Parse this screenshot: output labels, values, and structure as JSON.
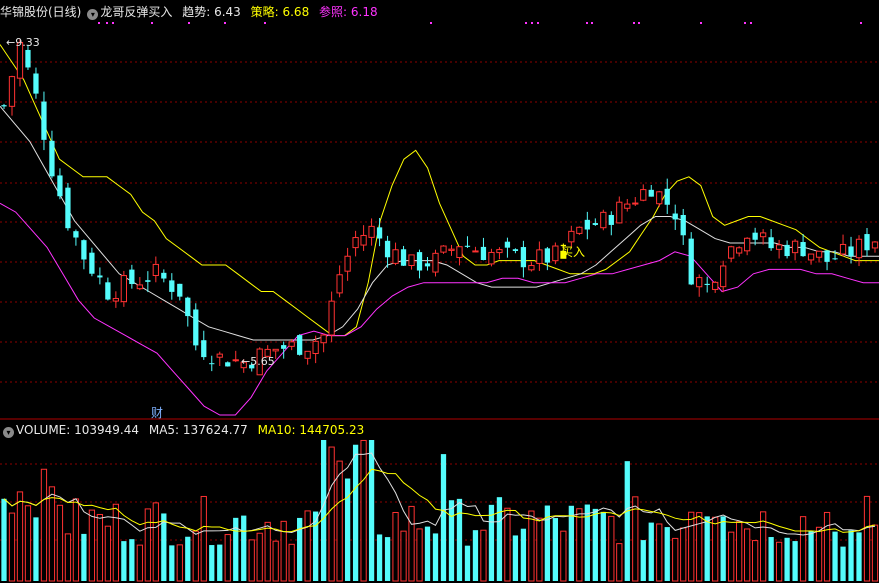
{
  "header": {
    "stock_name": "华锦股份(日线)",
    "indicator_name": "龙哥反弹买入",
    "trend_label": "趋势: ",
    "trend_value": "6.43",
    "strategy_label": "策略: ",
    "strategy_value": "6.68",
    "reference_label": "参照: ",
    "reference_value": "6.18"
  },
  "volume_header": {
    "volume_label": "VOLUME: ",
    "volume_value": "103949.44",
    "ma5_label": "MA5: ",
    "ma5_value": "137624.77",
    "ma10_label": "MA10: ",
    "ma10_value": "144705.23"
  },
  "annotations": {
    "high": "9.33",
    "low": "5.65",
    "buy": "买入",
    "finance": "财"
  },
  "colors": {
    "up": "#ff3232",
    "down": "#54fcfc",
    "trend": "#ffff00",
    "strategy": "#e0e0e0",
    "reference": "#ff33ff",
    "buy_bar": "#ffff00",
    "grid": "#8b0000"
  },
  "chart_data": [
    {
      "type": "candlestick",
      "series": [
        {
          "name": "趋势",
          "values": [
            9.3,
            9.1,
            8.9,
            8.6,
            8.3,
            8.0,
            7.9,
            7.8,
            7.8,
            7.8,
            7.7,
            7.6,
            7.4,
            7.3,
            7.1,
            7.0,
            6.9,
            6.8,
            6.8,
            6.8,
            6.7,
            6.6,
            6.5,
            6.5,
            6.4,
            6.3,
            6.2,
            6.1,
            6.0,
            6.0,
            6.1,
            6.6,
            7.3,
            7.7,
            8.0,
            8.1,
            7.9,
            7.5,
            7.2,
            6.9,
            6.8,
            6.8,
            6.85,
            6.85,
            6.85,
            6.85,
            6.8,
            6.75,
            6.7,
            6.7,
            6.7,
            6.75,
            6.85,
            6.95,
            7.15,
            7.35,
            7.6,
            7.75,
            7.8,
            7.7,
            7.35,
            7.25,
            7.3,
            7.35,
            7.35,
            7.3,
            7.25,
            7.2,
            7.1,
            7.0,
            6.95,
            6.9,
            6.85,
            6.85,
            6.85
          ]
        },
        {
          "name": "策略",
          "values": [
            8.6,
            8.4,
            8.2,
            7.9,
            7.6,
            7.3,
            7.1,
            6.9,
            6.7,
            6.6,
            6.5,
            6.4,
            6.3,
            6.2,
            6.1,
            6.05,
            6.0,
            5.95,
            5.95,
            5.95,
            5.95,
            5.95,
            6.0,
            6.1,
            6.3,
            6.6,
            6.8,
            6.85,
            6.85,
            6.85,
            6.8,
            6.7,
            6.6,
            6.55,
            6.55,
            6.55,
            6.55,
            6.6,
            6.65,
            6.7,
            6.8,
            6.95,
            7.1,
            7.25,
            7.35,
            7.35,
            7.3,
            7.2,
            7.1,
            7.05,
            7.05,
            7.05,
            7.05,
            7.0,
            7.0,
            6.95,
            6.95,
            6.9,
            6.9,
            6.9
          ]
        },
        {
          "name": "参照",
          "values": [
            7.5,
            7.4,
            7.2,
            7.0,
            6.7,
            6.4,
            6.2,
            6.1,
            6.0,
            5.9,
            5.8,
            5.6,
            5.4,
            5.2,
            5.1,
            5.1,
            5.3,
            5.6,
            5.8,
            6.0,
            6.05,
            6.0,
            6.0,
            6.1,
            6.3,
            6.45,
            6.55,
            6.6,
            6.6,
            6.6,
            6.6,
            6.6,
            6.65,
            6.65,
            6.6,
            6.6,
            6.6,
            6.65,
            6.7,
            6.7,
            6.75,
            6.8,
            6.85,
            6.95,
            6.9,
            6.7,
            6.5,
            6.55,
            6.7,
            6.75,
            6.75,
            6.75,
            6.7,
            6.7,
            6.65,
            6.6,
            6.6
          ]
        }
      ],
      "annotations": [
        {
          "text": "9.33",
          "y": 9.33
        },
        {
          "text": "5.65",
          "y": 5.65
        },
        {
          "text": "买入"
        }
      ]
    },
    {
      "type": "bar",
      "series": [
        {
          "name": "VOLUME",
          "values": [
            103949.44
          ]
        },
        {
          "name": "MA5",
          "values": [
            137624.77
          ]
        },
        {
          "name": "MA10",
          "values": [
            144705.23
          ]
        }
      ]
    }
  ]
}
